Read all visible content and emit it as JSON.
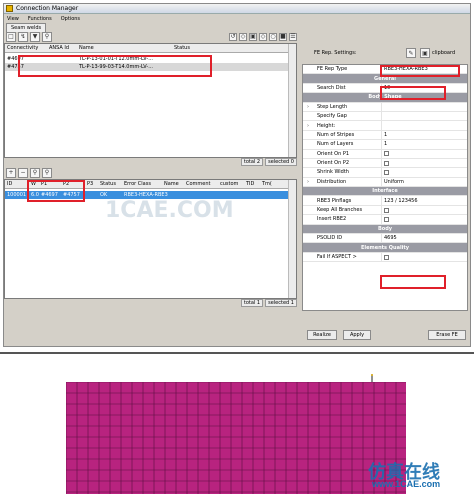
{
  "window": {
    "title": "Connection Manager"
  },
  "menubar": [
    "View",
    "Functions",
    "Options"
  ],
  "tab": {
    "label": "Seam welds"
  },
  "top_grid": {
    "columns": [
      "Connectivity",
      "ANSA Id",
      "Name",
      "Status"
    ],
    "rows": [
      {
        "connectivity": "#4697",
        "name": "TL-P-13-01-01-T12.0mm-LV-..."
      },
      {
        "connectivity": "#4757",
        "name": "TL-P-13-99-03-T14.0mm-LV-..."
      }
    ],
    "status": {
      "total": "total 2",
      "selected": "selected 0"
    }
  },
  "bottom_grid": {
    "columns": [
      "ID",
      "W",
      "P1",
      "P2",
      "P3",
      "Status",
      "Error Class",
      "Name",
      "Comment",
      "custom",
      "TID",
      "Tm("
    ],
    "rows": [
      {
        "id": "100001",
        "w": "6.0",
        "p1": "#4697",
        "p2": "#4757",
        "status": "OK",
        "error_class": "RBE3-HEXA-RBE3"
      }
    ],
    "status": {
      "total": "total 1",
      "selected": "selected 1"
    }
  },
  "fe_settings": {
    "label": "FE Rep. Settings:",
    "clipboard": "clipboard",
    "rows": [
      {
        "key": "FE Rep Type",
        "value": "RBE3-HEXA-RBE3",
        "kind": "value"
      },
      {
        "key": "General",
        "kind": "section"
      },
      {
        "key": "Search Dist",
        "value": "10",
        "kind": "value"
      },
      {
        "key": "Body Shape",
        "kind": "section"
      },
      {
        "key": "Step Length",
        "value": "",
        "kind": "expand"
      },
      {
        "key": "Specify Gap",
        "value": "",
        "kind": "value"
      },
      {
        "key": "Height:",
        "value": "",
        "kind": "expand"
      },
      {
        "key": "Num of Stripes",
        "value": "1",
        "kind": "value"
      },
      {
        "key": "Num of Layers",
        "value": "1",
        "kind": "value"
      },
      {
        "key": "Orient On P1",
        "kind": "check"
      },
      {
        "key": "Orient On P2",
        "kind": "check"
      },
      {
        "key": "Shrink Width",
        "kind": "check"
      },
      {
        "key": "Distribution",
        "value": "Uniform",
        "kind": "expand"
      },
      {
        "key": "Interface",
        "kind": "section"
      },
      {
        "key": "RBE3 Pinflags",
        "value": "123 / 123456",
        "kind": "value"
      },
      {
        "key": "Keep All Branches",
        "kind": "check"
      },
      {
        "key": "Insert RBE2",
        "kind": "check"
      },
      {
        "key": "Body",
        "kind": "section"
      },
      {
        "key": "PSOLID ID",
        "value": "4695",
        "kind": "value"
      },
      {
        "key": "Elements Quality",
        "kind": "section"
      },
      {
        "key": "Fail If ASPECT >",
        "kind": "check"
      }
    ]
  },
  "buttons": {
    "realize": "Realize",
    "apply": "Apply",
    "erase": "Erase FE"
  },
  "watermark": {
    "cae_text": "1CAE.COM",
    "logo_text": "仿真在线",
    "url_text": "www.1CAE.com"
  },
  "colors": {
    "section_bg": "#9a9ba4",
    "highlight_row": "#3a8fde",
    "annotation_red": "#e0202a",
    "mesh": "#b8237f"
  }
}
